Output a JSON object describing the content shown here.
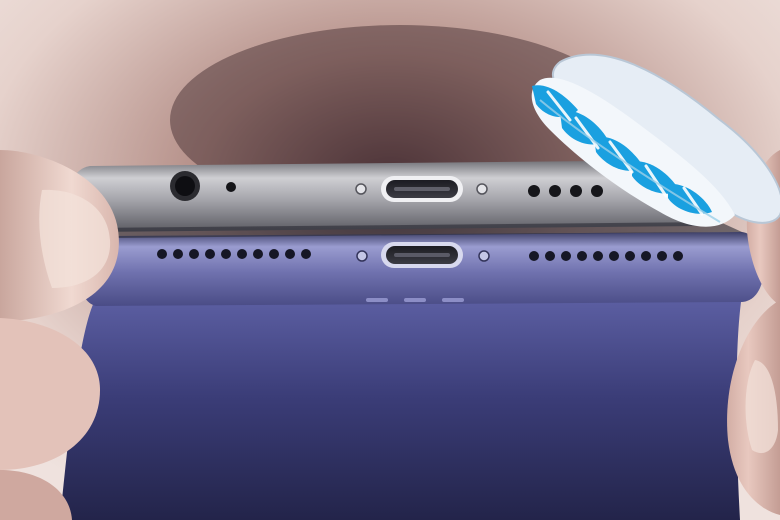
{
  "scene": {
    "subject": "two-smartphones-bottom-edge-with-toothbrush",
    "colors": {
      "background": "#e8d9d4",
      "skin_light": "#e9cdc4",
      "skin_shadow": "#b88f86",
      "phone_top_silver": "#9a9aa0",
      "phone_bottom_blue": "#5a5c9a",
      "brush_head": "#e8eef5",
      "bristle_blue": "#1aa0e0",
      "bristle_white": "#f4f8fb"
    },
    "icons": {
      "port": "lightning-port-icon",
      "jack": "headphone-jack-icon",
      "grille": "speaker-grille-icon",
      "screw": "pentalobe-screw-icon"
    }
  }
}
